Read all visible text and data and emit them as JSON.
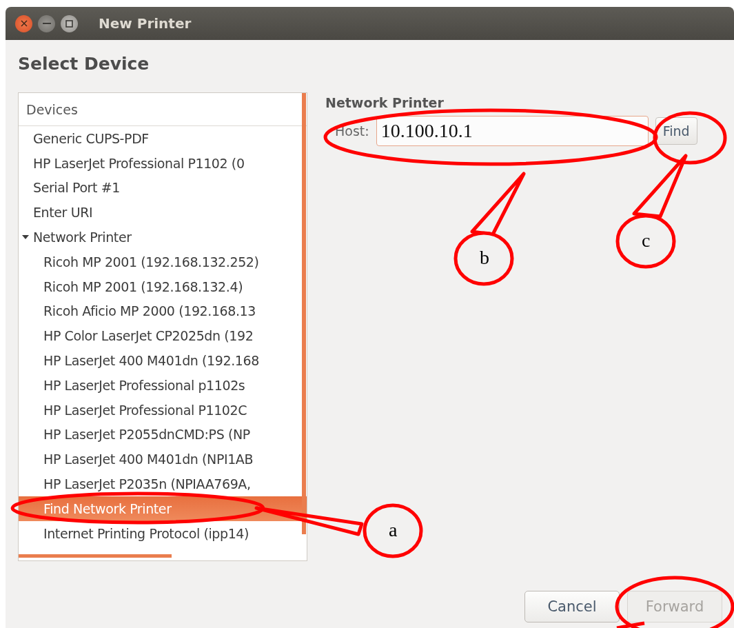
{
  "window": {
    "title": "New Printer"
  },
  "heading": "Select Device",
  "devices": {
    "header": "Devices",
    "items": [
      {
        "label": "Generic CUPS-PDF",
        "selected": false
      },
      {
        "label": "HP LaserJet Professional P1102 (0",
        "selected": false
      },
      {
        "label": "Serial Port #1",
        "selected": false
      },
      {
        "label": "Enter URI",
        "selected": false
      },
      {
        "label": "Network Printer",
        "selected": false,
        "expanded": true,
        "children": [
          {
            "label": "Ricoh MP 2001 (192.168.132.252)",
            "selected": false
          },
          {
            "label": "Ricoh MP 2001 (192.168.132.4)",
            "selected": false
          },
          {
            "label": "Ricoh Aficio MP 2000 (192.168.13",
            "selected": false
          },
          {
            "label": "HP Color LaserJet CP2025dn (192",
            "selected": false
          },
          {
            "label": "HP LaserJet 400 M401dn (192.168",
            "selected": false
          },
          {
            "label": "HP LaserJet Professional p1102s",
            "selected": false
          },
          {
            "label": "HP LaserJet Professional P1102C",
            "selected": false
          },
          {
            "label": "HP LaserJet P2055dnCMD:PS (NP",
            "selected": false
          },
          {
            "label": "HP LaserJet 400 M401dn (NPI1AB",
            "selected": false
          },
          {
            "label": "HP LaserJet P2035n (NPIAA769A,",
            "selected": false
          },
          {
            "label": "Find Network Printer",
            "selected": true
          },
          {
            "label": "Internet Printing Protocol (ipp14)",
            "selected": false
          }
        ]
      }
    ]
  },
  "network_printer": {
    "title": "Network Printer",
    "host_label": "Host:",
    "host_value": "10.100.10.1",
    "find_button": "Find"
  },
  "buttons": [
    {
      "label": "Cancel",
      "disabled": false
    },
    {
      "label": "Forward",
      "disabled": true
    }
  ],
  "annotations": [
    {
      "label": "a"
    },
    {
      "label": "b"
    },
    {
      "label": "c"
    }
  ]
}
